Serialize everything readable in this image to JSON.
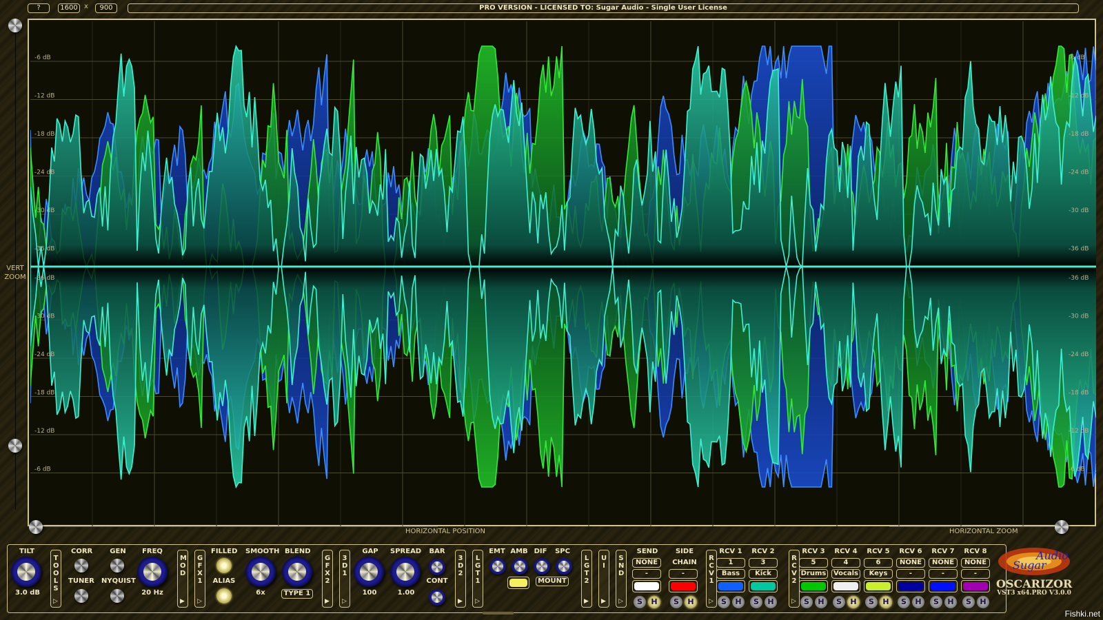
{
  "topbar": {
    "help_label": "?",
    "width_value": "1600",
    "x_separator": "x",
    "height_value": "900",
    "license_text": "PRO VERSION - LICENSED TO: Sugar Audio - Single User License"
  },
  "scope": {
    "db_labels_top": [
      "-6 dB",
      "-12 dB",
      "-18 dB",
      "-24 dB",
      "-30 dB",
      "-36 dB"
    ],
    "db_labels_bottom": [
      "-36 dB",
      "-30 dB",
      "-24 dB",
      "-18 dB",
      "-12 dB",
      "-6 dB"
    ],
    "colors": {
      "blue": "#1a4fd8",
      "green": "#33e83a",
      "cyan": "#3ff0d0",
      "background": "#0f0f03"
    },
    "vert_zoom_label": "VERT\nZOOM",
    "horizontal_position_label": "HORIZONTAL POSITION",
    "horizontal_zoom_label": "HORIZONTAL ZOOM"
  },
  "panel": {
    "tilt": {
      "label": "TILT",
      "value": "3.0 dB"
    },
    "tools_tab": "TOOLS",
    "corr_label": "CORR",
    "tuner_label": "TUNER",
    "gen_label": "GEN",
    "nyquist_label": "NYQUIST",
    "freq": {
      "label": "FREQ",
      "value": "20 Hz"
    },
    "mod_tab": "MOD",
    "gfx1_tab": "GFX1",
    "filled_label": "FILLED",
    "alias_label": "ALIAS",
    "smooth": {
      "label": "SMOOTH",
      "value": "6x"
    },
    "blend": {
      "label": "BLEND",
      "value": "TYPE 1"
    },
    "gfx2_tab": "GFX2",
    "3d1_tab": "3D1",
    "gap": {
      "label": "GAP",
      "value": "100"
    },
    "spread": {
      "label": "SPREAD",
      "value": "1.00"
    },
    "bar_label": "BAR",
    "cont_label": "CONT",
    "3d2_tab": "3D2",
    "lgt1_tab": "LGT1",
    "emt_label": "EMT",
    "amb_label": "AMB",
    "dif_label": "DIF",
    "spc_label": "SPC",
    "light_color": "#f5f060",
    "mount_label": "MOUNT",
    "lgt2_tab": "LGT2",
    "ui_tab": "UI",
    "snd_tab": "SND",
    "send": {
      "label": "SEND",
      "channel": "NONE",
      "name": "-",
      "color": "#ffffff",
      "s": "S",
      "h": "H"
    },
    "sidechain": {
      "label1": "SIDE",
      "label2": "CHAIN",
      "name": "-",
      "color": "#ff0000",
      "s": "S",
      "h": "H"
    },
    "rcv1_tab": "RCV1",
    "rcv2_tab": "RCV2",
    "receivers": [
      {
        "label": "RCV 1",
        "channel": "1",
        "name": "Bass",
        "color": "#1060ff",
        "s": "S",
        "h": "H",
        "h_active": false
      },
      {
        "label": "RCV 2",
        "channel": "3",
        "name": "Kick",
        "color": "#00c8a0",
        "s": "S",
        "h": "H",
        "h_active": false
      },
      {
        "label": "RCV 3",
        "channel": "5",
        "name": "Drums",
        "color": "#00c800",
        "s": "S",
        "h": "H",
        "h_active": false
      },
      {
        "label": "RCV 4",
        "channel": "4",
        "name": "Vocals",
        "color": "#f0f0f0",
        "s": "S",
        "h": "H",
        "h_active": true
      },
      {
        "label": "RCV 5",
        "channel": "6",
        "name": "Keys",
        "color": "#c8f030",
        "s": "S",
        "h": "H",
        "h_active": true
      },
      {
        "label": "RCV 6",
        "channel": "NONE",
        "name": "-",
        "color": "#0000a0",
        "s": "S",
        "h": "H",
        "h_active": false
      },
      {
        "label": "RCV 7",
        "channel": "NONE",
        "name": "-",
        "color": "#0010ff",
        "s": "S",
        "h": "H",
        "h_active": false
      },
      {
        "label": "RCV 8",
        "channel": "NONE",
        "name": "-",
        "color": "#a000b0",
        "s": "S",
        "h": "H",
        "h_active": false
      }
    ]
  },
  "branding": {
    "logo_line1": "Audio",
    "logo_line2": "Sugar",
    "product": "OSCARIZOR",
    "version": "VST3 x64.PRO V3.0.0"
  },
  "watermark": "Fishki.net"
}
